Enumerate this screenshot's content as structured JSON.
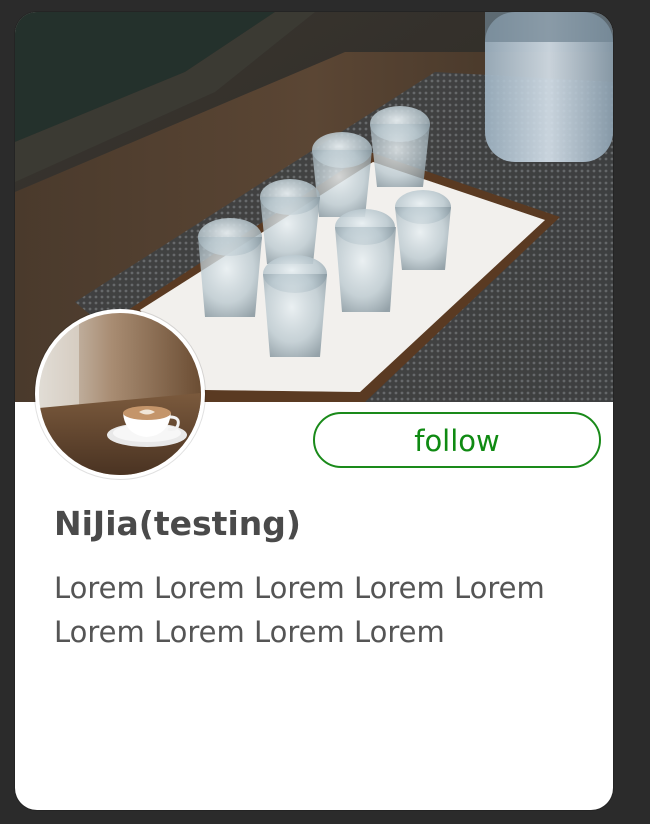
{
  "profile": {
    "name": "NiJia(testing)",
    "bio": "Lorem Lorem Lorem Lorem Lorem Lorem Lorem Lorem Lorem",
    "follow_label": "follow"
  },
  "colors": {
    "follow_accent": "#0f8a12",
    "page_background": "#2b2b2b",
    "card_background": "#ffffff"
  },
  "images": {
    "cover": "cover-photo-glasses-on-tray",
    "avatar": "avatar-latte-cup"
  }
}
